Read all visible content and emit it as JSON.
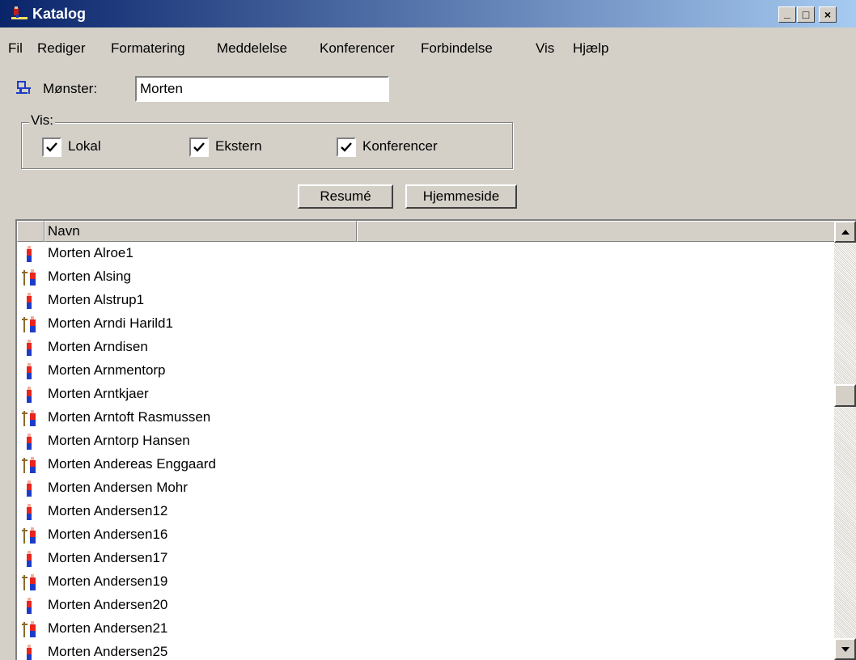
{
  "window": {
    "title": "Katalog",
    "icon": "katalog-app-icon",
    "controls": {
      "minimize": "_",
      "maximize": "□",
      "close": "×"
    }
  },
  "menu": [
    "Fil",
    "Rediger",
    "Formatering",
    "Meddelelse",
    "Konferencer",
    "Forbindelse",
    "Vis",
    "Hjælp"
  ],
  "pattern": {
    "label": "Mønster:",
    "value": "Morten",
    "icon": "search-person-icon"
  },
  "show_group": {
    "legend": "Vis:",
    "options": [
      {
        "label": "Lokal",
        "checked": true
      },
      {
        "label": "Ekstern",
        "checked": true
      },
      {
        "label": "Konferencer",
        "checked": true
      }
    ]
  },
  "buttons": {
    "summary": "Resumé",
    "homepage": "Hjemmeside"
  },
  "list": {
    "columns": [
      "",
      "Navn",
      ""
    ],
    "rows": [
      {
        "name": "Morten Alroe1",
        "icon": "person-icon"
      },
      {
        "name": "Morten Alsing",
        "icon": "remote-person-icon"
      },
      {
        "name": "Morten Alstrup1",
        "icon": "person-icon"
      },
      {
        "name": "Morten Arndi Harild1",
        "icon": "remote-person-icon"
      },
      {
        "name": "Morten Arndisen",
        "icon": "person-icon"
      },
      {
        "name": "Morten Arnmentorp",
        "icon": "person-icon"
      },
      {
        "name": "Morten Arntkjaer",
        "icon": "person-icon"
      },
      {
        "name": "Morten Arntoft Rasmussen",
        "icon": "remote-person-icon"
      },
      {
        "name": "Morten Arntorp Hansen",
        "icon": "person-icon"
      },
      {
        "name": "Morten Andereas Enggaard",
        "icon": "remote-person-icon"
      },
      {
        "name": "Morten Andersen Mohr",
        "icon": "person-icon"
      },
      {
        "name": "Morten Andersen12",
        "icon": "person-icon"
      },
      {
        "name": "Morten Andersen16",
        "icon": "remote-person-icon"
      },
      {
        "name": "Morten Andersen17",
        "icon": "person-icon"
      },
      {
        "name": "Morten Andersen19",
        "icon": "remote-person-icon"
      },
      {
        "name": "Morten Andersen20",
        "icon": "person-icon"
      },
      {
        "name": "Morten Andersen21",
        "icon": "remote-person-icon"
      },
      {
        "name": "Morten Andersen25",
        "icon": "person-icon"
      }
    ],
    "scroll_position": 0.38
  },
  "colors": {
    "title_start": "#0a246a",
    "title_end": "#a6caf0",
    "face": "#d4d0c8",
    "person_body": "#e8241c",
    "person_legs": "#1c3cc8",
    "person_head": "#f0b0a0",
    "pole": "#8a6a2a"
  }
}
